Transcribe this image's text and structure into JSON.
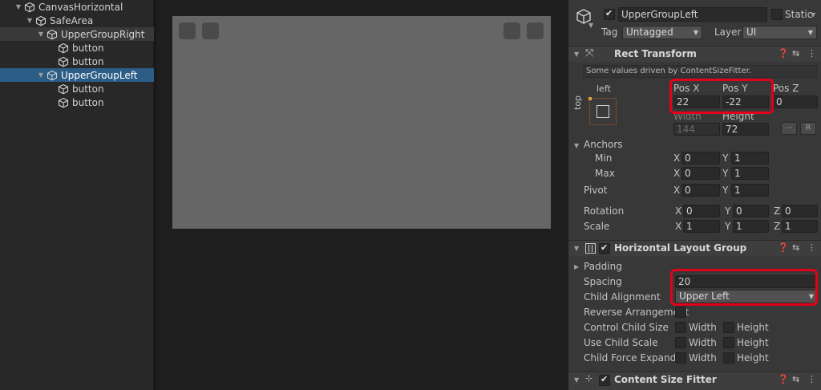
{
  "hierarchy": {
    "items": [
      {
        "label": "CanvasHorizontal",
        "indent": 0,
        "fold": "open",
        "state": "normal"
      },
      {
        "label": "SafeArea",
        "indent": 1,
        "fold": "open",
        "state": "normal"
      },
      {
        "label": "UpperGroupRight",
        "indent": 2,
        "fold": "open",
        "state": "hover"
      },
      {
        "label": "button",
        "indent": 3,
        "fold": "none",
        "state": "normal"
      },
      {
        "label": "button",
        "indent": 3,
        "fold": "none",
        "state": "normal"
      },
      {
        "label": "UpperGroupLeft",
        "indent": 2,
        "fold": "open",
        "state": "selected"
      },
      {
        "label": "button",
        "indent": 3,
        "fold": "none",
        "state": "normal"
      },
      {
        "label": "button",
        "indent": 3,
        "fold": "none",
        "state": "normal"
      }
    ]
  },
  "inspector": {
    "object_name": "UpperGroupLeft",
    "static_label": "Static",
    "tag_label": "Tag",
    "tag_value": "Untagged",
    "layer_label": "Layer",
    "layer_value": "UI",
    "rect_transform": {
      "title": "Rect Transform",
      "note": "Some values driven by ContentSizeFitter.",
      "anchor_h": "left",
      "anchor_v": "top",
      "pos_x_label": "Pos X",
      "pos_y_label": "Pos Y",
      "pos_z_label": "Pos Z",
      "pos_x": "22",
      "pos_y": "-22",
      "pos_z": "0",
      "width_label": "Width",
      "height_label": "Height",
      "width": "144",
      "height": "72",
      "raw_button": "R",
      "anchors_label": "Anchors",
      "min_label": "Min",
      "max_label": "Max",
      "min_x": "0",
      "min_y": "1",
      "max_x": "0",
      "max_y": "1",
      "pivot_label": "Pivot",
      "pivot_x": "0",
      "pivot_y": "1",
      "rotation_label": "Rotation",
      "rot_x": "0",
      "rot_y": "0",
      "rot_z": "0",
      "scale_label": "Scale",
      "scale_x": "1",
      "scale_y": "1",
      "scale_z": "1",
      "axis_x": "X",
      "axis_y": "Y",
      "axis_z": "Z"
    },
    "horizontal_layout": {
      "title": "Horizontal Layout Group",
      "padding_label": "Padding",
      "spacing_label": "Spacing",
      "spacing": "20",
      "child_alignment_label": "Child Alignment",
      "child_alignment": "Upper Left",
      "reverse_label": "Reverse Arrangement",
      "control_child_size_label": "Control Child Size",
      "use_child_scale_label": "Use Child Scale",
      "child_force_expand_label": "Child Force Expand",
      "width_label": "Width",
      "height_label": "Height"
    },
    "content_size_fitter": {
      "title": "Content Size Fitter"
    }
  },
  "colors": {
    "selection": "#2c5d87",
    "highlight_box": "#e2001a",
    "scene_canvas": "#666666"
  }
}
